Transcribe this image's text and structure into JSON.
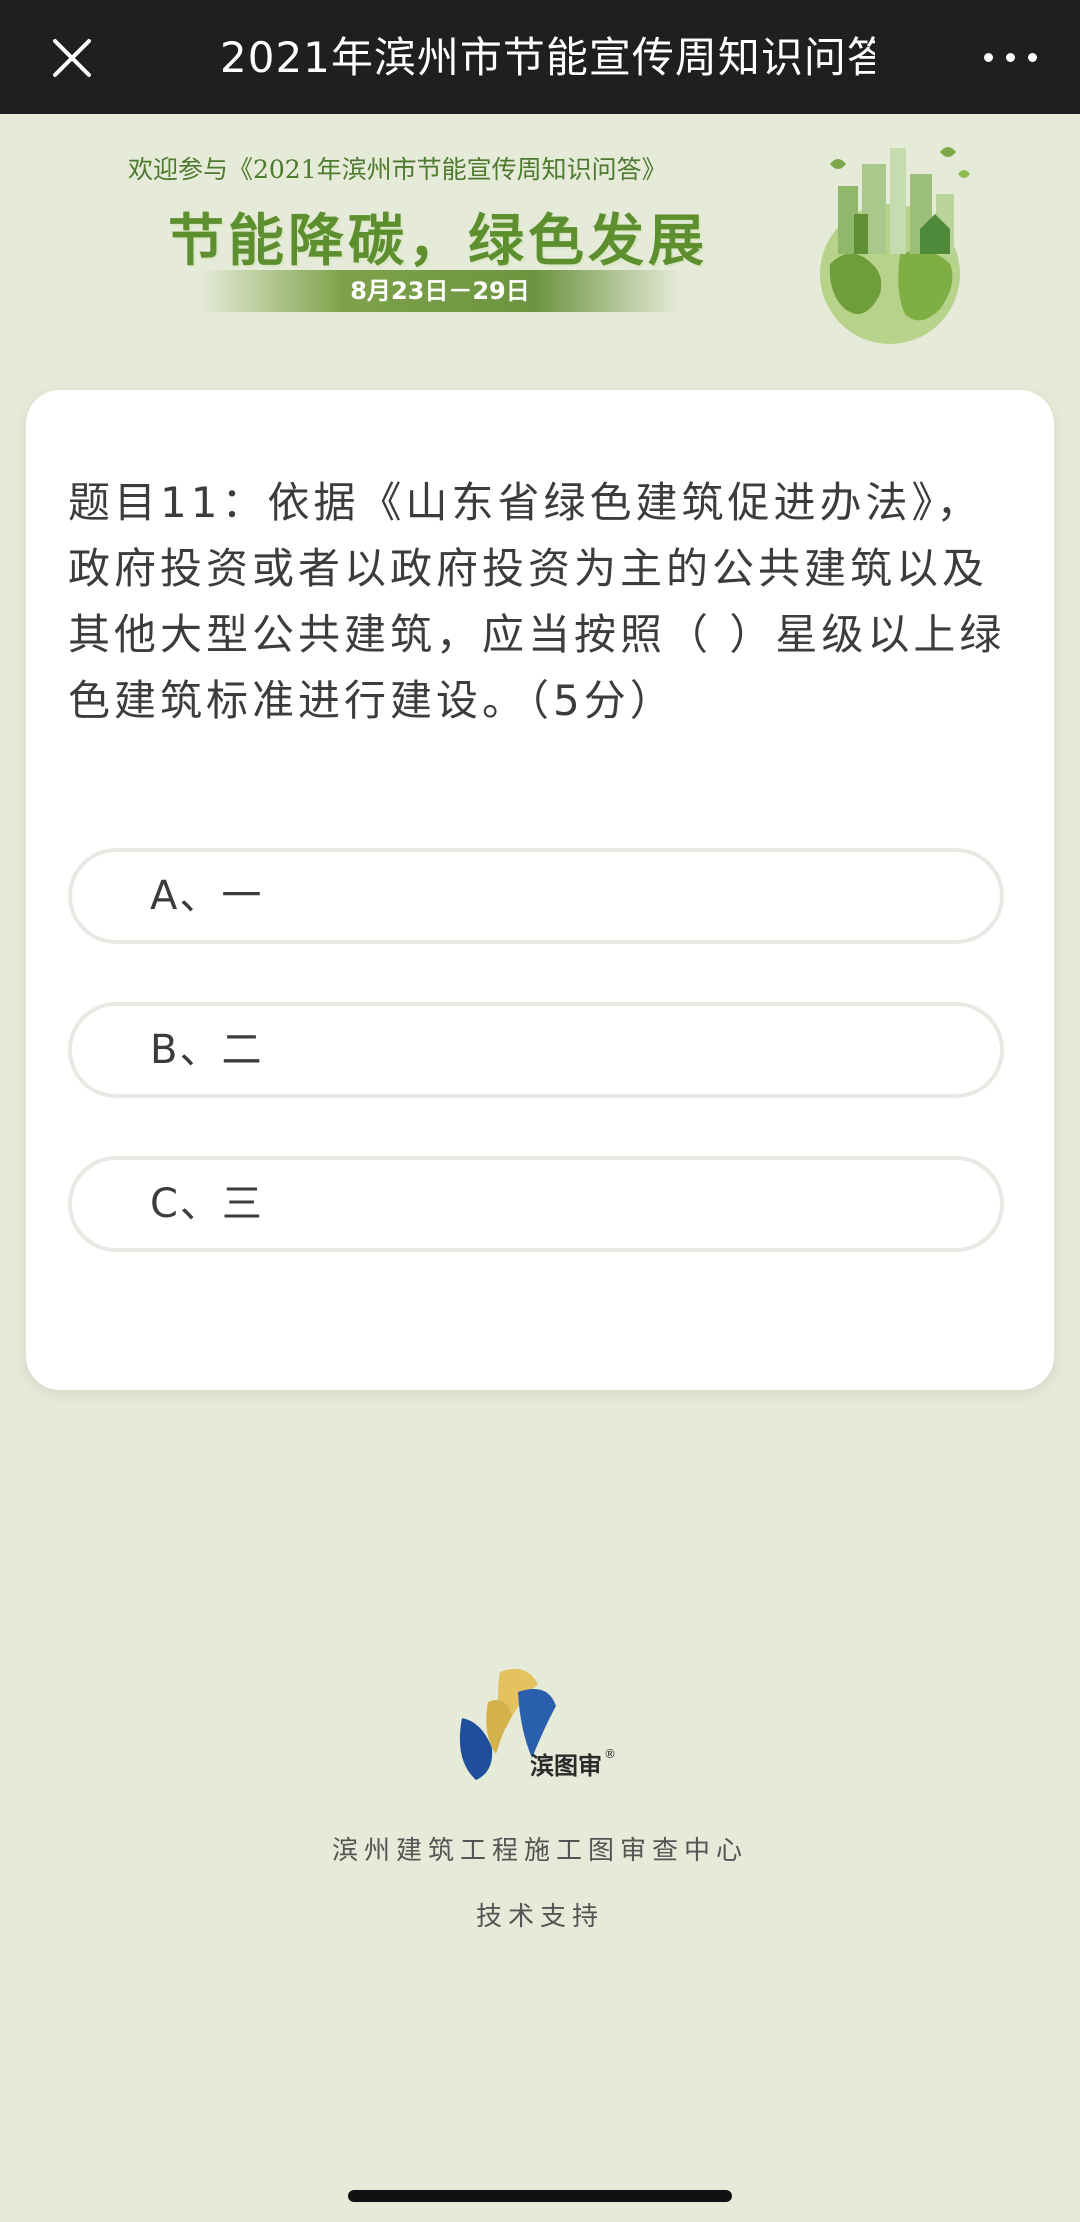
{
  "nav": {
    "title": "2021年滨州市节能宣传周知识问答",
    "close_icon": "close-icon",
    "more_icon": "more-dots-icon"
  },
  "banner": {
    "welcome": "欢迎参与《2021年滨州市节能宣传周知识问答》",
    "slogan": "节能降碳，绿色发展",
    "date": "8月23日－29日",
    "illustration": "green-city-earth-illustration"
  },
  "question": {
    "text": "题目11：依据《山东省绿色建筑促进办法》，政府投资或者以政府投资为主的公共建筑以及其他大型公共建筑，应当按照（ ）星级以上绿色建筑标准进行建设。（5分）",
    "options": [
      {
        "label": "A、一"
      },
      {
        "label": "B、二"
      },
      {
        "label": "C、三"
      }
    ]
  },
  "footer": {
    "logo_text": "滨图审",
    "logo_mark": "®",
    "organization": "滨州建筑工程施工图审查中心",
    "support": "技术支持"
  },
  "colors": {
    "page_bg": "#e6ead8",
    "topbar_bg": "#1f1f1f",
    "accent_green": "#5d8f2f",
    "card_bg": "#ffffff"
  }
}
